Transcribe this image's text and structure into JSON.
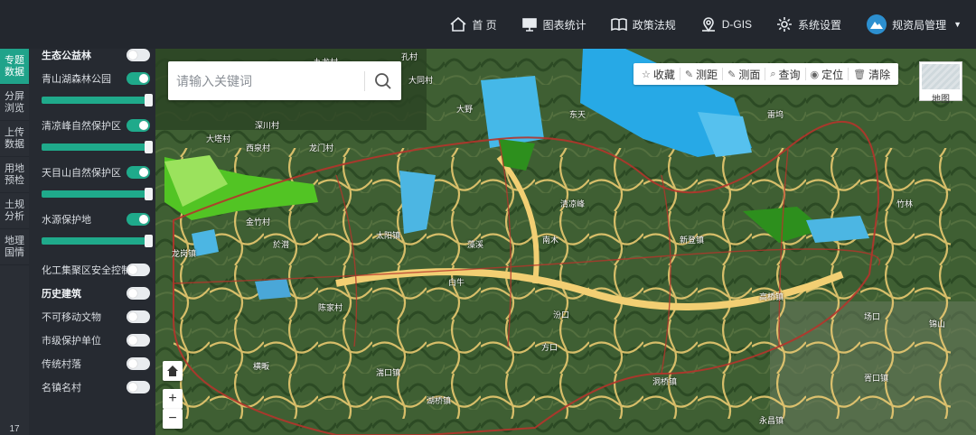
{
  "nav": {
    "items": [
      {
        "label": "首 页",
        "icon": "home-icon"
      },
      {
        "label": "图表统计",
        "icon": "chart-board-icon"
      },
      {
        "label": "政策法规",
        "icon": "book-icon"
      },
      {
        "label": "D-GIS",
        "icon": "map-pin-icon"
      },
      {
        "label": "系统设置",
        "icon": "gear-icon"
      }
    ],
    "user": "规资局管理"
  },
  "left_tabs": [
    {
      "label": "专题数据",
      "active": true
    },
    {
      "label": "分屏浏览"
    },
    {
      "label": "上传数据"
    },
    {
      "label": "用地预检"
    },
    {
      "label": "土规分析"
    },
    {
      "label": "地理国情"
    }
  ],
  "left_tabs_bottom": "17",
  "layers": {
    "group1_title": "生态公益林",
    "items": [
      {
        "label": "青山湖森林公园",
        "on": true,
        "opacity": 1.0
      },
      {
        "label": "清凉峰自然保护区",
        "on": true,
        "opacity": 1.0
      },
      {
        "label": "天目山自然保护区",
        "on": true,
        "opacity": 1.0
      },
      {
        "label": "水源保护地",
        "on": true,
        "opacity": 1.0
      }
    ],
    "chemical": "化工集聚区安全控制线",
    "group2_title": "历史建筑",
    "group2": [
      "不可移动文物",
      "市级保护单位",
      "传统村落",
      "名镇名村"
    ]
  },
  "search": {
    "placeholder": "请输入关键词"
  },
  "toolbar": [
    {
      "label": "收藏",
      "icon": "star-icon"
    },
    {
      "label": "测距",
      "icon": "ruler-icon"
    },
    {
      "label": "测面",
      "icon": "area-icon"
    },
    {
      "label": "查询",
      "icon": "search-icon"
    },
    {
      "label": "定位",
      "icon": "location-icon"
    },
    {
      "label": "清除",
      "icon": "trash-icon"
    }
  ],
  "minimap_label": "地图",
  "zoom": {
    "in": "+",
    "out": "−"
  },
  "map_labels": [
    "孔村",
    "九龙村",
    "大同村",
    "大野",
    "东天",
    "雷坞",
    "大塔村",
    "深川村",
    "西泉村",
    "龙门村",
    "金竹村",
    "於潜",
    "太阳镇",
    "藻溪",
    "南木",
    "清凉峰",
    "陈家村",
    "龙岗镇",
    "白牛",
    "汾口",
    "横畈",
    "湍口镇",
    "湖桥镇",
    "方口",
    "竹林",
    "新登镇",
    "洞桥镇",
    "高桥镇",
    "永昌镇",
    "胥口镇",
    "锦山",
    "场口"
  ],
  "colors": {
    "accent": "#20a38a",
    "topbar": "#23272e",
    "panel": "#262a31"
  }
}
